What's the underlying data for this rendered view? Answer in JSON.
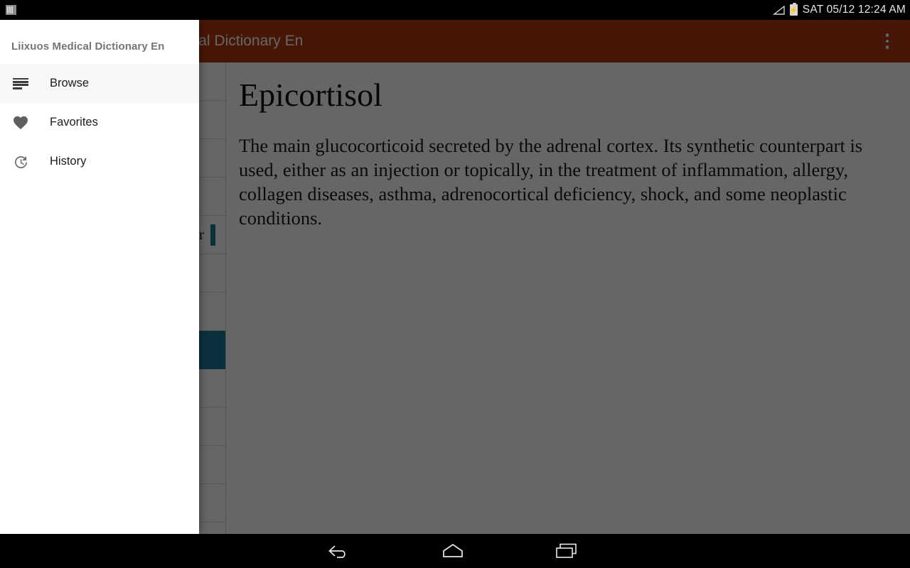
{
  "status_bar": {
    "notification_icon": "notification-bars-icon",
    "signal_icon": "signal-triangle-icon",
    "battery_icon": "battery-charging-icon",
    "clock": "SAT 05/12 12:24 AM"
  },
  "action_bar": {
    "title": "Liixuos Medical Dictionary En",
    "visible_title_fragment": "ary En",
    "background_color": "#b03a10",
    "overflow_icon": "overflow-menu-icon"
  },
  "drawer": {
    "header": "Liixuos Medical Dictionary En",
    "open": true,
    "items": [
      {
        "label": "Browse",
        "icon": "browse-list-icon",
        "active": true
      },
      {
        "label": "Favorites",
        "icon": "heart-icon",
        "active": false
      },
      {
        "label": "History",
        "icon": "history-clock-icon",
        "active": false
      }
    ]
  },
  "list_pane": {
    "accent_color": "#1d7a99",
    "rows": [
      {
        "text": "",
        "accent": false,
        "selected": false
      },
      {
        "text": "",
        "accent": false,
        "selected": false
      },
      {
        "text": "",
        "accent": false,
        "selected": false
      },
      {
        "text": "",
        "accent": false,
        "selected": false
      },
      {
        "text": "Epicorticotropin transmitter",
        "accent": true,
        "selected": false
      },
      {
        "text": "",
        "accent": false,
        "selected": false
      },
      {
        "text": "",
        "accent": false,
        "selected": false
      },
      {
        "text": "",
        "accent": false,
        "selected": true
      },
      {
        "text": "",
        "accent": false,
        "selected": false
      },
      {
        "text": "",
        "accent": false,
        "selected": false
      },
      {
        "text": "",
        "accent": false,
        "selected": false
      },
      {
        "text": "",
        "accent": false,
        "selected": false
      }
    ]
  },
  "detail": {
    "title": "Epicortisol",
    "definition": "The main glucocorticoid secreted by the adrenal cortex. Its synthetic counterpart is used, either as an injection or topically, in the treatment of inflammation, allergy, collagen diseases, asthma, adrenocortical deficiency, shock, and some neoplastic conditions."
  },
  "nav_bar": {
    "back": "back-icon",
    "home": "home-icon",
    "recents": "recents-icon"
  }
}
